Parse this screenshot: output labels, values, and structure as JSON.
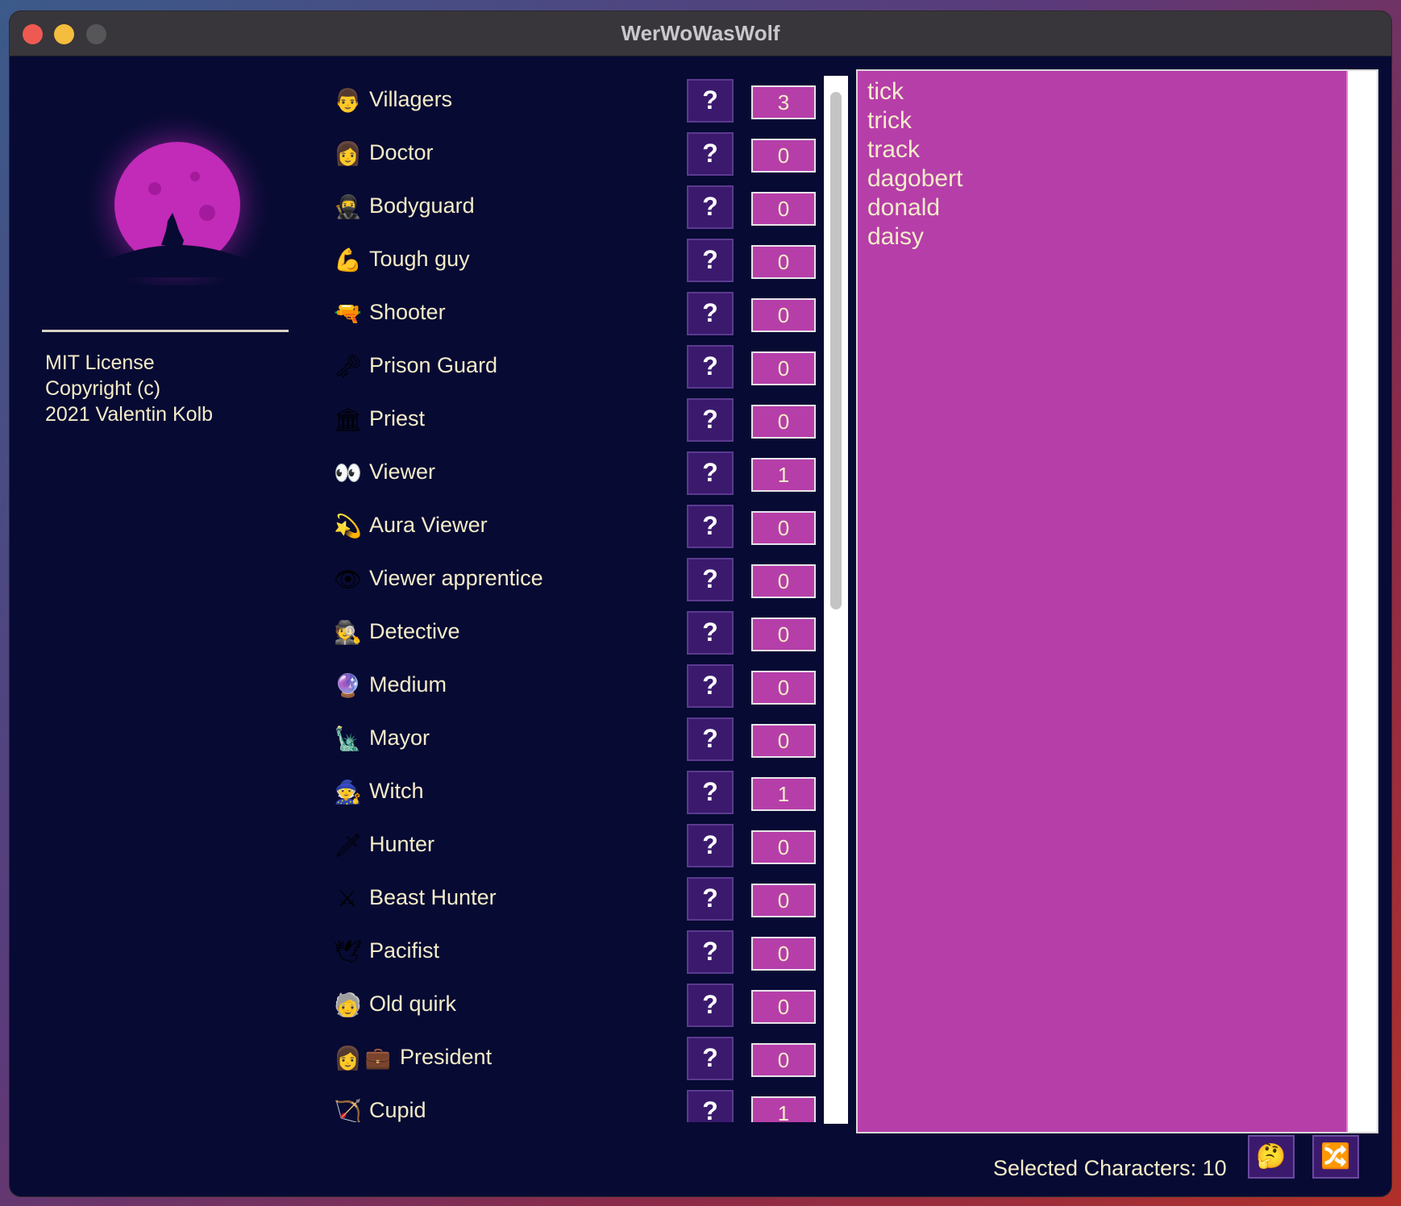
{
  "window": {
    "title": "WerWoWasWolf"
  },
  "license": {
    "text": "MIT License\nCopyright (c)\n2021 Valentin Kolb"
  },
  "roles": [
    {
      "icon": "👨",
      "icon_name": "villager-icon",
      "label": "Villagers",
      "count": "3"
    },
    {
      "icon": "👩",
      "icon_name": "doctor-icon",
      "label": "Doctor",
      "count": "0"
    },
    {
      "icon": "🥷",
      "icon_name": "ninja-icon",
      "label": "Bodyguard",
      "count": "0"
    },
    {
      "icon": "💪",
      "icon_name": "flexed-biceps-icon",
      "label": "Tough guy",
      "count": "0"
    },
    {
      "icon": "🔫",
      "icon_name": "water-pistol-icon",
      "label": "Shooter",
      "count": "0"
    },
    {
      "icon": "🗝",
      "icon_name": "old-key-icon",
      "label": "Prison Guard",
      "count": "0"
    },
    {
      "icon": "🏛",
      "icon_name": "church-icon",
      "label": "Priest",
      "count": "0"
    },
    {
      "icon": "👀",
      "icon_name": "eyes-icon",
      "label": "Viewer",
      "count": "1"
    },
    {
      "icon": "💫",
      "icon_name": "dizzy-icon",
      "label": "Aura Viewer",
      "count": "0"
    },
    {
      "icon": "👁",
      "icon_name": "eye-icon",
      "label": "Viewer apprentice",
      "count": "0"
    },
    {
      "icon": "🕵",
      "icon_name": "detective-icon",
      "label": "Detective",
      "count": "0"
    },
    {
      "icon": "🔮",
      "icon_name": "crystal-ball-icon",
      "label": "Medium",
      "count": "0"
    },
    {
      "icon": "🗽",
      "icon_name": "statue-of-liberty-icon",
      "label": "Mayor",
      "count": "0"
    },
    {
      "icon": "🧙",
      "icon_name": "witch-icon",
      "label": "Witch",
      "count": "1"
    },
    {
      "icon": "🗡",
      "icon_name": "dagger-icon",
      "label": "Hunter",
      "count": "0"
    },
    {
      "icon": "⚔",
      "icon_name": "crossed-swords-icon",
      "label": "Beast Hunter",
      "count": "0"
    },
    {
      "icon": "🕊",
      "icon_name": "dove-icon",
      "label": "Pacifist",
      "count": "0"
    },
    {
      "icon": "🧓",
      "icon_name": "older-person-icon",
      "label": "Old quirk",
      "count": "0"
    },
    {
      "icon": "👩",
      "icon2": "💼",
      "icon_name": "president-icon",
      "label": "President",
      "count": "0"
    },
    {
      "icon": "🏹",
      "icon_name": "bow-and-arrow-icon",
      "label": "Cupid",
      "count": "1"
    }
  ],
  "help_label": "?",
  "names": [
    "tick",
    "trick",
    "track",
    "dagobert",
    "donald",
    "daisy"
  ],
  "footer": {
    "selected_label": "Selected Characters: 10",
    "think_icon": "🤔",
    "shuffle_icon": "🔀"
  },
  "colors": {
    "background": "#070a33",
    "accent": "#b63ea9",
    "button": "#3b1a6e",
    "text": "#f4ecc8"
  }
}
